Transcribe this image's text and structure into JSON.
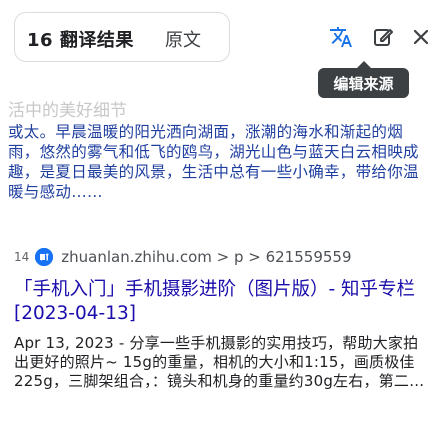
{
  "tabs": {
    "active": "16 翻译结果",
    "inactive": "原文"
  },
  "tooltip": "编辑来源",
  "faded_title": "活中的美好细节",
  "snippet": "或太。早晨温暖的阳光洒向湖面，涨潮的海水和渐起的烟雨，悠然的雾气和低飞的鸥鸟，湖光山色与蓝天白云相映成趣，是夏日最美的风景，生活中总有一些小确幸，带给你温暖与感动……",
  "result": {
    "index": "14",
    "url": "zhuanlan.zhihu.com > p > 621559559",
    "title": "「手机入门」手机摄影进阶（图片版）- 知乎专栏 [2023-04-13]",
    "description": "Apr 13, 2023 - 分享一些手机摄影的实用技巧，帮助大家拍出更好的照片~ 15g的重量，相机的大小和1:15，画质极佳225g，三脚架组合，：镜头和机身的重量约30g左右，第二…"
  },
  "colors": {
    "tooltip_bg": "#3c4043",
    "link": "#1a0dab",
    "snippet_text": "#1f3fa0",
    "favicon": "#1772f6"
  }
}
